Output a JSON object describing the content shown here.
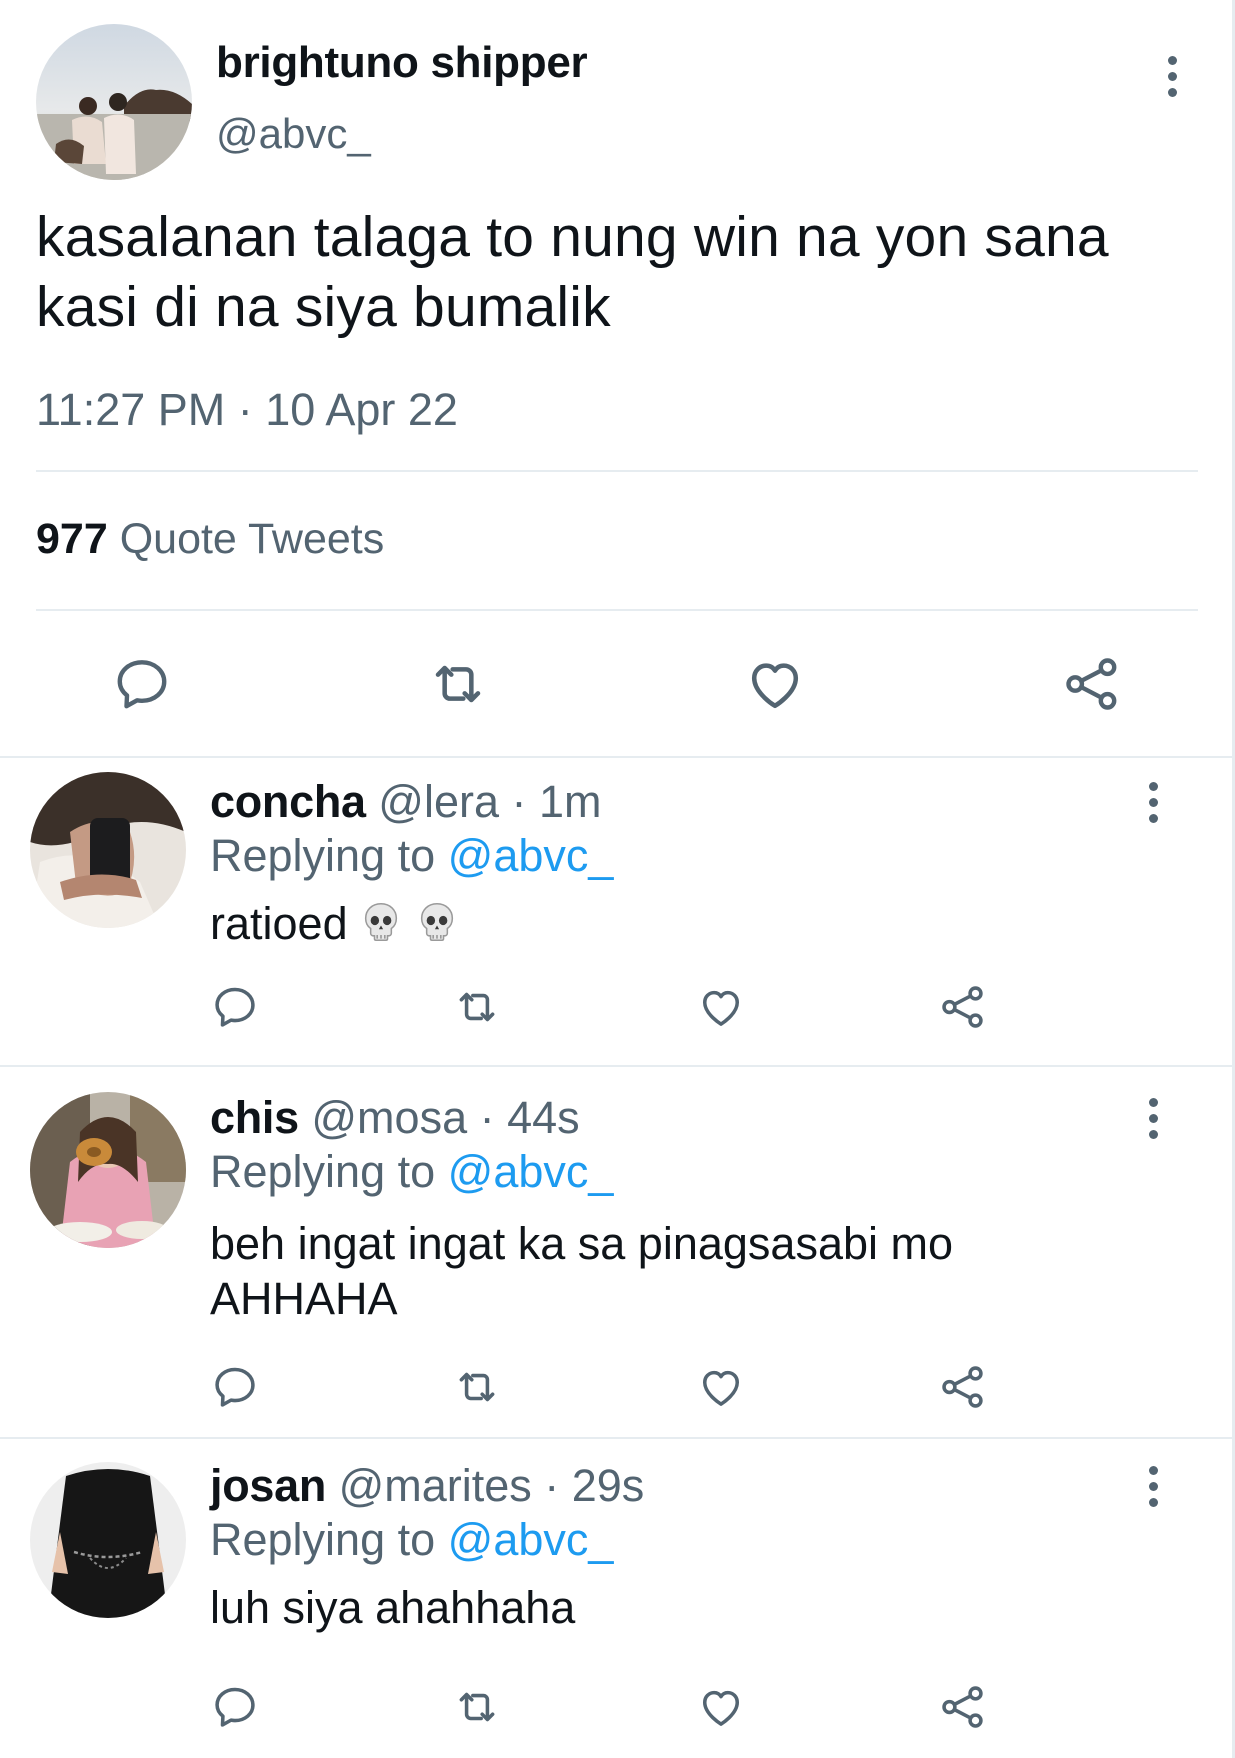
{
  "main_tweet": {
    "display_name": "brightuno shipper",
    "handle": "@abvc_",
    "text": "kasalanan talaga to nung win na yon sana kasi di na siya bumalik",
    "timestamp": "11:27 PM · 10 Apr 22",
    "quote_count": "977",
    "quote_label": "Quote Tweets",
    "actions": [
      "reply-icon",
      "retweet-icon",
      "like-icon",
      "share-icon"
    ]
  },
  "replies": [
    {
      "name": "concha",
      "meta": "@lera · 1m",
      "replying_prefix": "Replying to",
      "replying_handle": "@abvc_",
      "text": "ratioed",
      "emojis": [
        "skull-emoji",
        "skull-emoji"
      ]
    },
    {
      "name": "chis",
      "meta": "@mosa · 44s",
      "replying_prefix": "Replying to",
      "replying_handle": "@abvc_",
      "text_line1": "beh ingat ingat ka sa pinagsasabi mo",
      "text_line2": "AHHAHA"
    },
    {
      "name": "josan",
      "meta": "@marites · 29s",
      "replying_prefix": "Replying to",
      "replying_handle": "@abvc_",
      "text": "luh siya ahahhaha"
    }
  ],
  "colors": {
    "text_primary": "#0f1419",
    "text_secondary": "#536471",
    "link": "#1d9bf0",
    "divider": "#e6ecf0"
  }
}
